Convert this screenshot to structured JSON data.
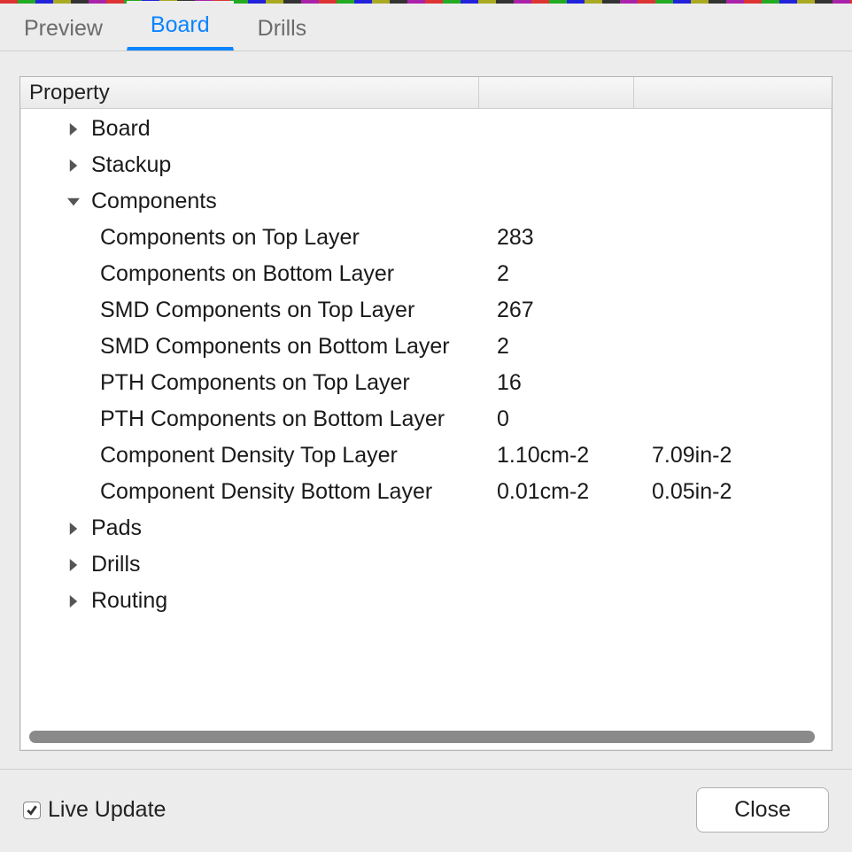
{
  "tabs": {
    "preview": "Preview",
    "board": "Board",
    "drills": "Drills",
    "active": "board"
  },
  "table": {
    "header": "Property"
  },
  "tree": {
    "board": "Board",
    "stackup": "Stackup",
    "components": "Components",
    "pads": "Pads",
    "drills": "Drills",
    "routing": "Routing"
  },
  "components": {
    "rows": [
      {
        "label": "Components on Top Layer",
        "v1": "283",
        "v2": ""
      },
      {
        "label": "Components on Bottom Layer",
        "v1": "2",
        "v2": ""
      },
      {
        "label": "SMD Components on Top Layer",
        "v1": "267",
        "v2": ""
      },
      {
        "label": "SMD Components on Bottom Layer",
        "v1": "2",
        "v2": ""
      },
      {
        "label": "PTH Components on Top Layer",
        "v1": "16",
        "v2": ""
      },
      {
        "label": "PTH Components on Bottom Layer",
        "v1": "0",
        "v2": ""
      },
      {
        "label": "Component Density Top Layer",
        "v1": "1.10cm-2",
        "v2": "7.09in-2"
      },
      {
        "label": "Component Density Bottom Layer",
        "v1": "0.01cm-2",
        "v2": "0.05in-2"
      }
    ]
  },
  "footer": {
    "live_update_label": "Live Update",
    "live_update_checked": true,
    "close_label": "Close"
  }
}
